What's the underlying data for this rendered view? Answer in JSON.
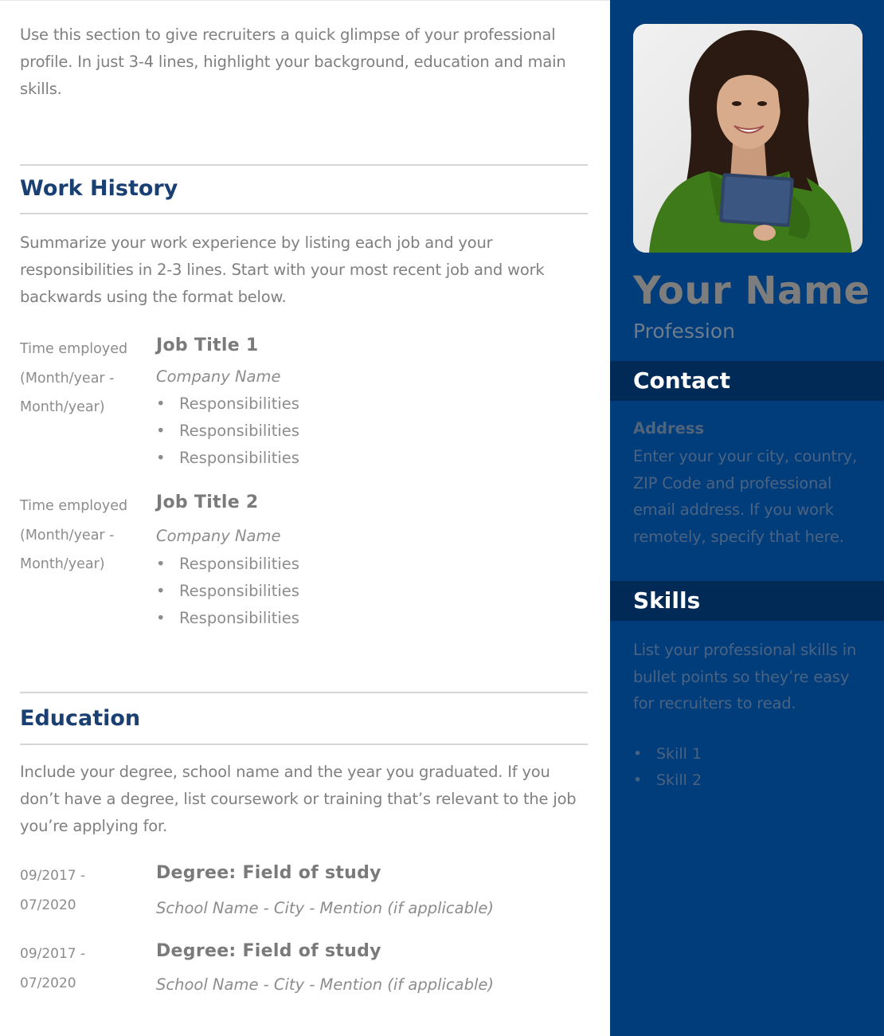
{
  "summary": {
    "text": "Use this section to give recruiters a quick glimpse of your professional profile. In just 3-4 lines, highlight your background, education and main skills."
  },
  "work_history": {
    "title": "Work History",
    "intro": "Summarize your work experience by listing each job and your responsibilities in 2-3 lines. Start with your most recent job and work backwards using the format below.",
    "jobs": [
      {
        "date": "Time employed (Month/year - Month/year)",
        "title": "Job Title 1",
        "company": "Company Name",
        "responsibilities": [
          "Responsibilities",
          "Responsibilities",
          "Responsibilities"
        ]
      },
      {
        "date": "Time employed (Month/year - Month/year)",
        "title": "Job Title 2",
        "company": "Company Name",
        "responsibilities": [
          "Responsibilities",
          "Responsibilities",
          "Responsibilities"
        ]
      }
    ]
  },
  "education": {
    "title": "Education",
    "intro": "Include your degree, school name and the year you graduated. If you don’t have a degree, list coursework or training that’s relevant to the job you’re applying for.",
    "entries": [
      {
        "date": "09/2017 - 07/2020",
        "degree": "Degree: Field of study",
        "school": "School Name - City - Mention (if applicable)"
      },
      {
        "date": "09/2017 - 07/2020",
        "degree": "Degree: Field of study",
        "school": "School Name - City - Mention (if applicable)"
      }
    ]
  },
  "sidebar": {
    "name": "Your Name",
    "profession": "Profession",
    "contact": {
      "title": "Contact",
      "address_label": "Address",
      "address_text": "Enter your your city, country, ZIP Code and professional email address. If you work remotely, specify that here."
    },
    "skills": {
      "title": "Skills",
      "intro": "List your professional skills in bullet points so they’re easy for recruiters to read.",
      "items": [
        "Skill 1",
        "Skill 2"
      ]
    }
  },
  "colors": {
    "sidebar_background": "#013d7a",
    "sidebar_band": "#012a56",
    "heading_blue": "#1a3f73",
    "body_gray": "#7f7f7f"
  },
  "bullet_glyph": "•"
}
